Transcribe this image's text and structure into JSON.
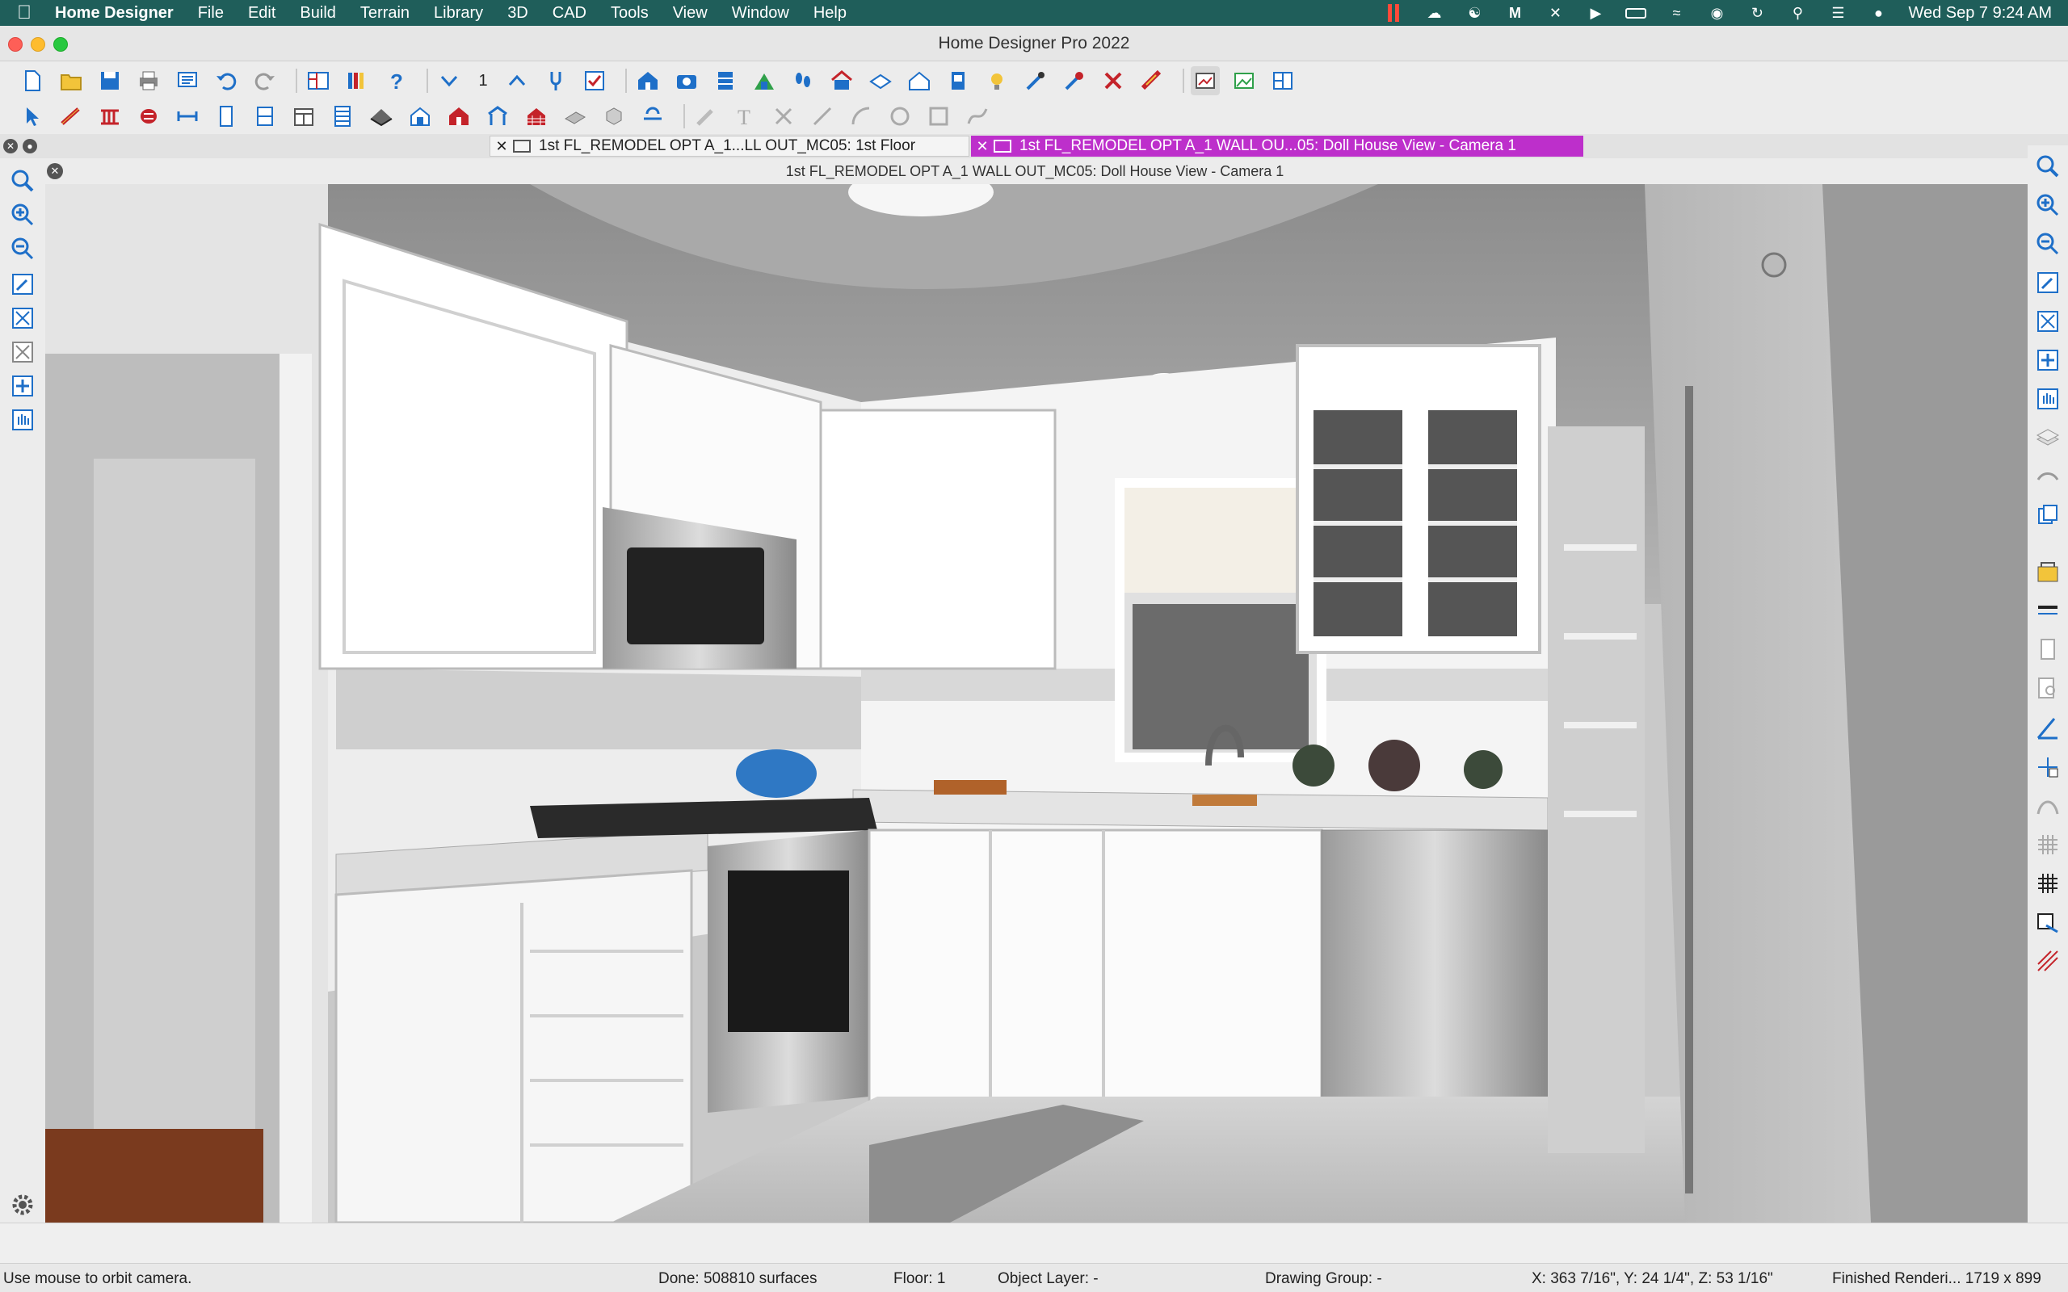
{
  "menubar": {
    "app_name": "Home Designer",
    "items": [
      "File",
      "Edit",
      "Build",
      "Terrain",
      "Library",
      "3D",
      "CAD",
      "Tools",
      "View",
      "Window",
      "Help"
    ],
    "clock": "Wed Sep 7  9:24 AM"
  },
  "window": {
    "title": "Home Designer Pro 2022"
  },
  "toolbar": {
    "floor_number": "1"
  },
  "tabs": [
    {
      "label": "1st FL_REMODEL OPT A_1...LL OUT_MC05: 1st Floor",
      "active": false
    },
    {
      "label": "1st FL_REMODEL OPT A_1 WALL OU...05: Doll House View - Camera 1",
      "active": true
    }
  ],
  "view": {
    "title": "1st FL_REMODEL OPT A_1 WALL OUT_MC05: Doll House View - Camera 1"
  },
  "status": {
    "hint": "Use mouse to orbit camera.",
    "done": "Done:  508810 surfaces",
    "floor": "Floor: 1",
    "object_layer": "Object Layer: -",
    "drawing_group": "Drawing Group: -",
    "coords": "X: 363 7/16\", Y: 24 1/4\", Z: 53 1/16\"",
    "render": "Finished Renderi...  1719 x 899"
  },
  "colors": {
    "menubar_bg": "#1f5e5a",
    "active_tab": "#bd2fcb",
    "toolbar_blue": "#1e6fc8",
    "toolbar_red": "#c4232a"
  }
}
